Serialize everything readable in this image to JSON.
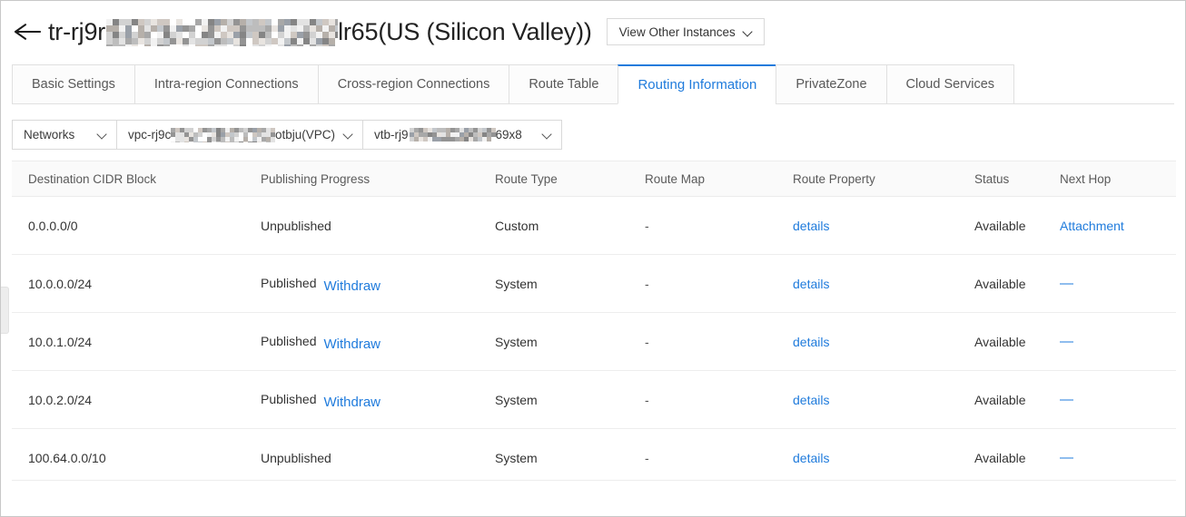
{
  "header": {
    "back_icon": "back-arrow-icon",
    "title_prefix": "tr-rj9r",
    "title_redacted": "[redacted]",
    "title_suffix": "lr65(US (Silicon Valley))",
    "view_other_instances_label": "View Other Instances",
    "dropdown_icon": "chevron-down-icon"
  },
  "tabs": [
    {
      "label": "Basic Settings",
      "active": false
    },
    {
      "label": "Intra-region Connections",
      "active": false
    },
    {
      "label": "Cross-region Connections",
      "active": false
    },
    {
      "label": "Route Table",
      "active": false
    },
    {
      "label": "Routing Information",
      "active": true
    },
    {
      "label": "PrivateZone",
      "active": false
    },
    {
      "label": "Cloud Services",
      "active": false
    }
  ],
  "filters": [
    {
      "name": "networks",
      "value": "Networks",
      "redacted": false,
      "prefix": "",
      "suffix": ""
    },
    {
      "name": "vpc",
      "value": "vpc-rj9c…otbju(VPC)",
      "redacted": true,
      "prefix": "vpc-rj9c",
      "suffix": "otbju(VPC)"
    },
    {
      "name": "vtb",
      "value": "vtb-rj9…69x8",
      "redacted": true,
      "prefix": "vtb-rj9",
      "suffix": "69x8"
    }
  ],
  "table": {
    "columns": [
      "Destination CIDR Block",
      "Publishing Progress",
      "Route Type",
      "Route Map",
      "Route Property",
      "Status",
      "Next Hop"
    ],
    "rows": [
      {
        "cidr": "0.0.0.0/0",
        "publishing_status": "Unpublished",
        "publishing_action": "",
        "route_type": "Custom",
        "route_map": "-",
        "route_property": "details",
        "status": "Available",
        "next_hop": "Attachment",
        "next_hop_is_link": true
      },
      {
        "cidr": "10.0.0.0/24",
        "publishing_status": "Published",
        "publishing_action": "Withdraw",
        "route_type": "System",
        "route_map": "-",
        "route_property": "details",
        "status": "Available",
        "next_hop": "—",
        "next_hop_is_link": false
      },
      {
        "cidr": "10.0.1.0/24",
        "publishing_status": "Published",
        "publishing_action": "Withdraw",
        "route_type": "System",
        "route_map": "-",
        "route_property": "details",
        "status": "Available",
        "next_hop": "—",
        "next_hop_is_link": false
      },
      {
        "cidr": "10.0.2.0/24",
        "publishing_status": "Published",
        "publishing_action": "Withdraw",
        "route_type": "System",
        "route_map": "-",
        "route_property": "details",
        "status": "Available",
        "next_hop": "—",
        "next_hop_is_link": false
      },
      {
        "cidr": "100.64.0.0/10",
        "publishing_status": "Unpublished",
        "publishing_action": "",
        "route_type": "System",
        "route_map": "-",
        "route_property": "details",
        "status": "Available",
        "next_hop": "—",
        "next_hop_is_link": false
      }
    ]
  },
  "colors": {
    "link": "#1f7bdc",
    "active_tab": "#1f7bdc",
    "text": "#333333",
    "header_bg": "#fafafa",
    "border": "#e0e0e0"
  }
}
